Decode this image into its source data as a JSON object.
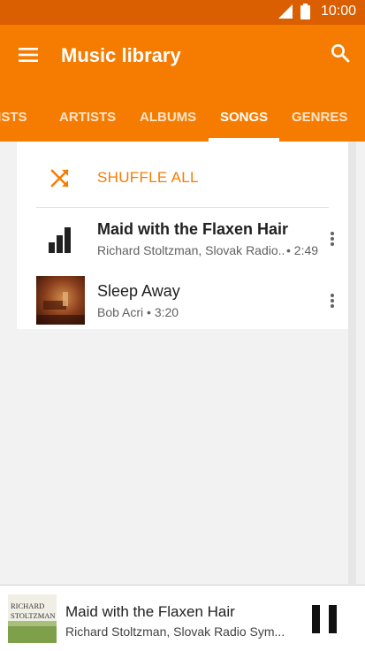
{
  "status_bar": {
    "time": "10:00"
  },
  "app_bar": {
    "title": "Music library"
  },
  "tabs": [
    {
      "label": "LISTS",
      "active": false
    },
    {
      "label": "ARTISTS",
      "active": false
    },
    {
      "label": "ALBUMS",
      "active": false
    },
    {
      "label": "SONGS",
      "active": true
    },
    {
      "label": "GENRES",
      "active": false
    }
  ],
  "shuffle": {
    "label": "SHUFFLE ALL",
    "icon": "shuffle-icon"
  },
  "songs": [
    {
      "title": "Maid with the Flaxen Hair",
      "artist": "Richard Stoltzman, Slovak Radio..",
      "duration": "• 2:49",
      "now_playing": true,
      "icon": "equalizer-icon"
    },
    {
      "title": "Sleep Away",
      "artist": "Bob Acri • 3:20",
      "duration": "",
      "now_playing": false,
      "icon": "album-art"
    }
  ],
  "now_playing": {
    "title": "Maid with the Flaxen Hair",
    "artist": "Richard Stoltzman, Slovak Radio Sym...",
    "art_text": [
      "RICHARD",
      "STOLTZMAN"
    ],
    "icon": "pause-icon"
  },
  "colors": {
    "accent": "#f57c00",
    "status_bar": "#d95f00"
  }
}
